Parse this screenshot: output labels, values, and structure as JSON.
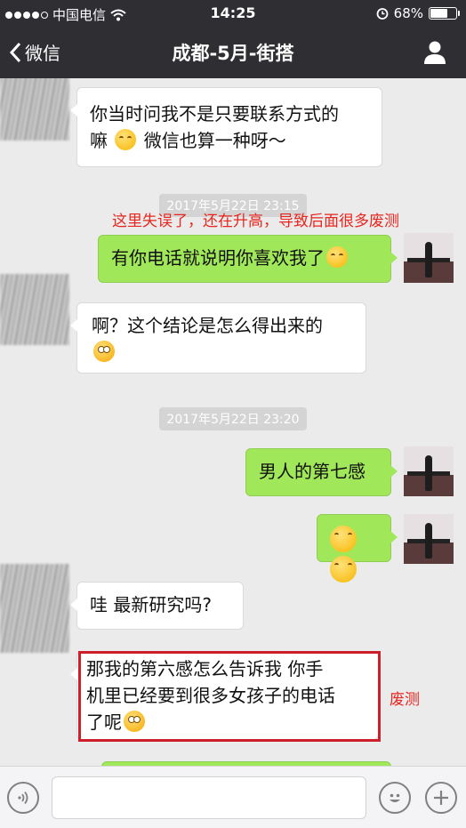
{
  "status_bar": {
    "carrier": "中国电信",
    "time": "14:25",
    "battery_percent": "68%",
    "battery_level": 0.68
  },
  "nav": {
    "back_label": "微信",
    "title": "成都-5月-街搭"
  },
  "messages": [
    {
      "side": "left",
      "text_lines": [
        "你当时问我不是只要联系方式的",
        "嘛",
        "微信也算一种呀～"
      ]
    },
    {
      "side": "right",
      "text": "有你电话就说明你喜欢我了"
    },
    {
      "side": "left",
      "text": "啊？这个结论是怎么得出来的"
    },
    {
      "side": "right",
      "text": "男人的第七感"
    },
    {
      "side": "right",
      "text": ""
    },
    {
      "side": "left",
      "text": "哇 最新研究吗?"
    },
    {
      "side": "left",
      "text_lines": [
        "那我的第六感怎么告诉我 你手",
        "机里已经要到很多女孩子的电话",
        "了呢"
      ]
    }
  ],
  "timestamps": [
    "2017年5月22日  23:15",
    "2017年5月22日  23:20"
  ],
  "annotations": {
    "note_1": "这里失误了，还在升高，导致后面很多废测",
    "note_2": "废测"
  },
  "colors": {
    "header_bg": "#2e2e33",
    "chat_bg": "#ebebeb",
    "green_bubble": "#a0e75a",
    "annotation_red": "#e8261f"
  },
  "icons": [
    "back-chevron-icon",
    "wifi-icon",
    "alarm-icon",
    "battery-icon",
    "contact-icon",
    "voice-icon",
    "emoji-icon",
    "plus-icon"
  ]
}
